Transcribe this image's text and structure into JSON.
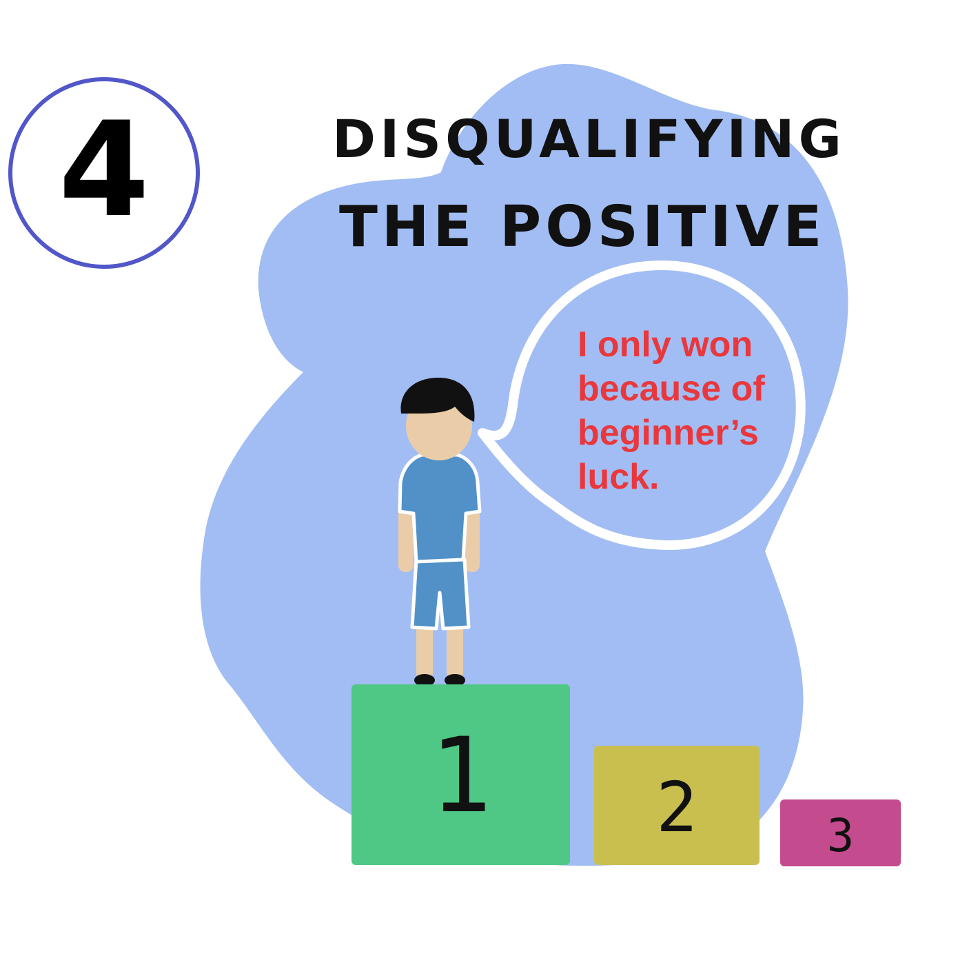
{
  "number": "4",
  "title": {
    "line1": "DISQUALIFYING",
    "line2": "THE POSITIVE"
  },
  "speech": {
    "lines": [
      "I only won",
      "because of",
      "beginner’s",
      "luck."
    ]
  },
  "podiums": [
    {
      "label": "1",
      "color": "#4fc785"
    },
    {
      "label": "2",
      "color": "#c9bf4f"
    },
    {
      "label": "3",
      "color": "#c54b8f"
    }
  ],
  "colors": {
    "blob": "#a2bdf3",
    "circle": "#5157c8",
    "speech_text": "#e8383d",
    "shirt": "#5191c8",
    "skin": "#eacda8",
    "hair": "#111111"
  }
}
